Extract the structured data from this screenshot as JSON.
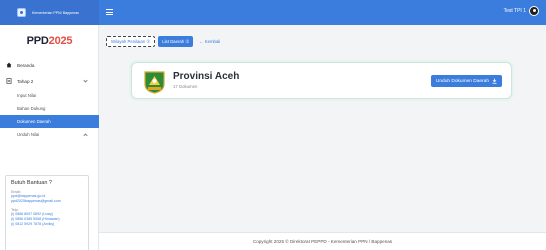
{
  "header": {
    "brand_text": "Kementerian PPN/ Bappenas",
    "user_name": "Test TPI 1",
    "colors": {
      "primary": "#3b7ddd",
      "brand_bg": "#3a73cf"
    }
  },
  "sidebar": {
    "logo_main": "PPD",
    "logo_year": "2025",
    "items": [
      {
        "label": "Beranda",
        "icon": "home-icon"
      },
      {
        "label": "Tahap 2",
        "icon": "document-icon"
      }
    ],
    "sub_items": [
      "Input Nilai",
      "Bahan Dukung",
      "Dokumen Daerah",
      "Unduh Nilai"
    ],
    "active_sub": "Dokumen Daerah"
  },
  "help": {
    "title": "Butuh Bantuan ?",
    "email_label": "Email:",
    "emails": [
      "ppd@bappenas.go.id",
      "ppd2025bappenas@gmail.com"
    ],
    "wa_label": "Telp:",
    "phones": [
      "(i) 0866 8097 0892 (Lusty)",
      "(i) 0856 0385 5558 (Himawan)",
      "(i) 0812 5929 7878 (Arviky)"
    ]
  },
  "tabs": {
    "wilayah": "Wilayah Penilaian ①",
    "list": "List Daerah ①",
    "back": "← Kembali"
  },
  "card": {
    "title": "Provinsi Aceh",
    "subtitle": "17 Dokumen",
    "button": "Unduh Dokumen Daerah",
    "emblem_icon": "aceh-emblem-icon"
  },
  "footer": {
    "text": "Copyright 2025 © Direktorat PEPPD - Kementerian PPN / Bappenas"
  }
}
